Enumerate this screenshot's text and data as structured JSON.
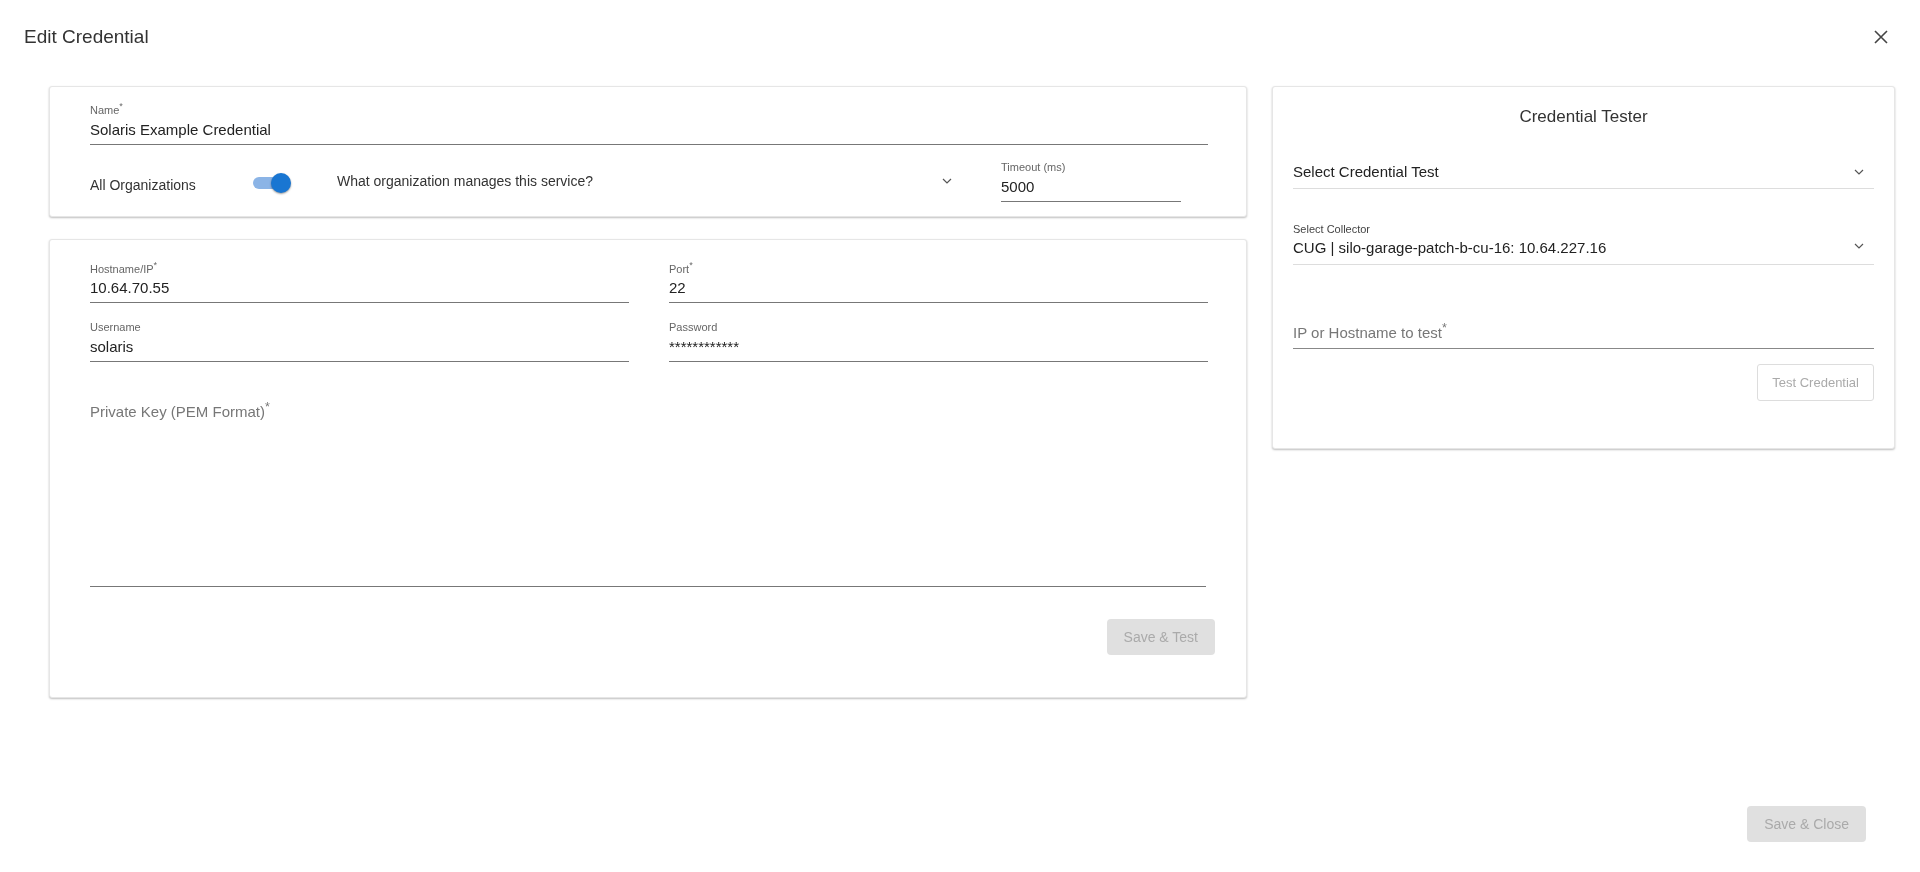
{
  "dialog": {
    "title": "Edit Credential"
  },
  "general": {
    "name": {
      "label": "Name$^{*}$",
      "value": "Solaris Example Credential"
    },
    "all_organizations": {
      "label": "All Organizations",
      "on": true
    },
    "organization": {
      "placeholder": "What organization manages this service?"
    },
    "timeout": {
      "label": "Timeout (ms)",
      "value": "5000"
    }
  },
  "connection": {
    "fields": [
      {
        "label": "Hostname/IP$^{*}$",
        "value": "10.64.70.55"
      },
      {
        "label": "Port$^{*}$",
        "value": "22"
      },
      {
        "label": "Username",
        "value": "solaris"
      },
      {
        "label": "Password",
        "value": "************"
      }
    ],
    "private_key": {
      "placeholder": "Private Key (PEM Format)$^{*}$"
    },
    "save_test": {
      "label": "Save & Test",
      "disabled": true
    }
  },
  "tester": {
    "title": "Credential Tester",
    "test_select": {
      "placeholder": "Select Credential Test"
    },
    "collector": {
      "label": "Select Collector",
      "value": "CUG | silo-garage-patch-b-cu-16: 10.64.227.16"
    },
    "target": {
      "placeholder": "IP or Hostname to test$^{*}$"
    },
    "test_button": {
      "label": "Test Credential",
      "disabled": true
    }
  },
  "save_close": {
    "label": "Save & Close",
    "disabled": true
  }
}
